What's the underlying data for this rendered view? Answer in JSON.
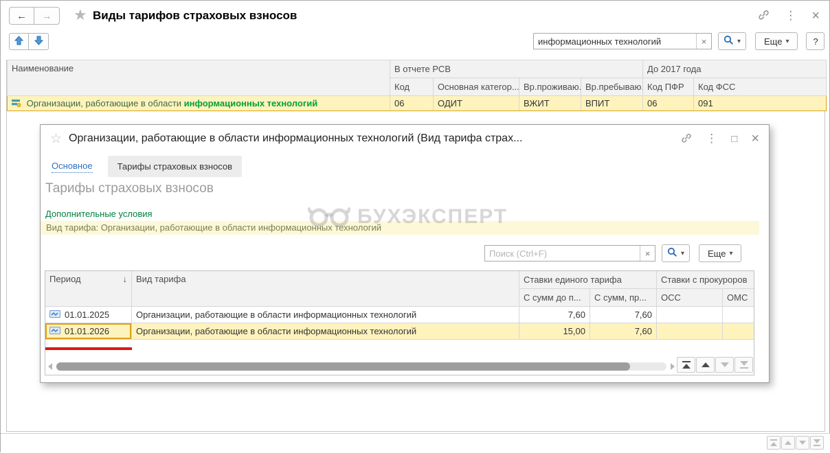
{
  "icons": {
    "back": "←",
    "forward": "→",
    "star": "★",
    "star_outline": "☆",
    "kebab": "⋮",
    "close": "×",
    "maximize": "□",
    "caret_down": "▾",
    "clear": "×",
    "sort_down": "↓",
    "help": "?"
  },
  "window": {
    "title": "Виды тарифов страховых взносов",
    "search_value": "информационных технологий",
    "more_label": "Еще",
    "help_label": "?"
  },
  "main_table": {
    "group_rsv": "В отчете РСВ",
    "group_2017": "До 2017 года",
    "col_name": "Наименование",
    "col_code": "Код",
    "col_category": "Основная категор...",
    "col_resident": "Вр.проживаю...",
    "col_staying": "Вр.пребываю...",
    "col_pfr": "Код ПФР",
    "col_fss": "Код ФСС",
    "row": {
      "name_prefix": "Организации, работающие в области ",
      "name_highlight": "информационных технологий",
      "code": "06",
      "category": "ОДИТ",
      "resident": "ВЖИТ",
      "staying": "ВПИТ",
      "pfr": "06",
      "fss": "091"
    }
  },
  "dialog": {
    "title": "Организации, работающие в области информационных технологий (Вид тарифа страх...",
    "tab_main": "Основное",
    "tab_tariffs": "Тарифы страховых взносов",
    "heading": "Тарифы страховых взносов",
    "conditions_link": "Дополнительные условия",
    "filter_bar": "Вид тарифа: Организации, работающие в области информационных технологий",
    "search_placeholder": "Поиск (Ctrl+F)",
    "more_label": "Еще",
    "table": {
      "col_period": "Период",
      "col_kind": "Вид тарифа",
      "group_unified": "Ставки единого тарифа",
      "col_under": "С сумм до п...",
      "col_over": "С сумм, пр...",
      "group_prosecutors": "Ставки с прокуроров",
      "col_oss": "ОСС",
      "col_oms": "ОМС",
      "rows": [
        {
          "period": "01.01.2025",
          "kind": "Организации, работающие в области информационных технологий",
          "under": "7,60",
          "over": "7,60",
          "oss": "",
          "oms": ""
        },
        {
          "period": "01.01.2026",
          "kind": "Организации, работающие в области информационных технологий",
          "under": "15,00",
          "over": "7,60",
          "oss": "",
          "oms": ""
        }
      ]
    }
  },
  "watermark": "БУХЭКСПЕРТ",
  "colors": {
    "selection_bg": "#fff3bd",
    "selection_border": "#d9a41c",
    "search_match_green": "#00a038",
    "link_blue": "#3072be",
    "link_green": "#00813c",
    "filter_bar_bg": "#fcf8d8",
    "annotation_red": "#e01616"
  }
}
